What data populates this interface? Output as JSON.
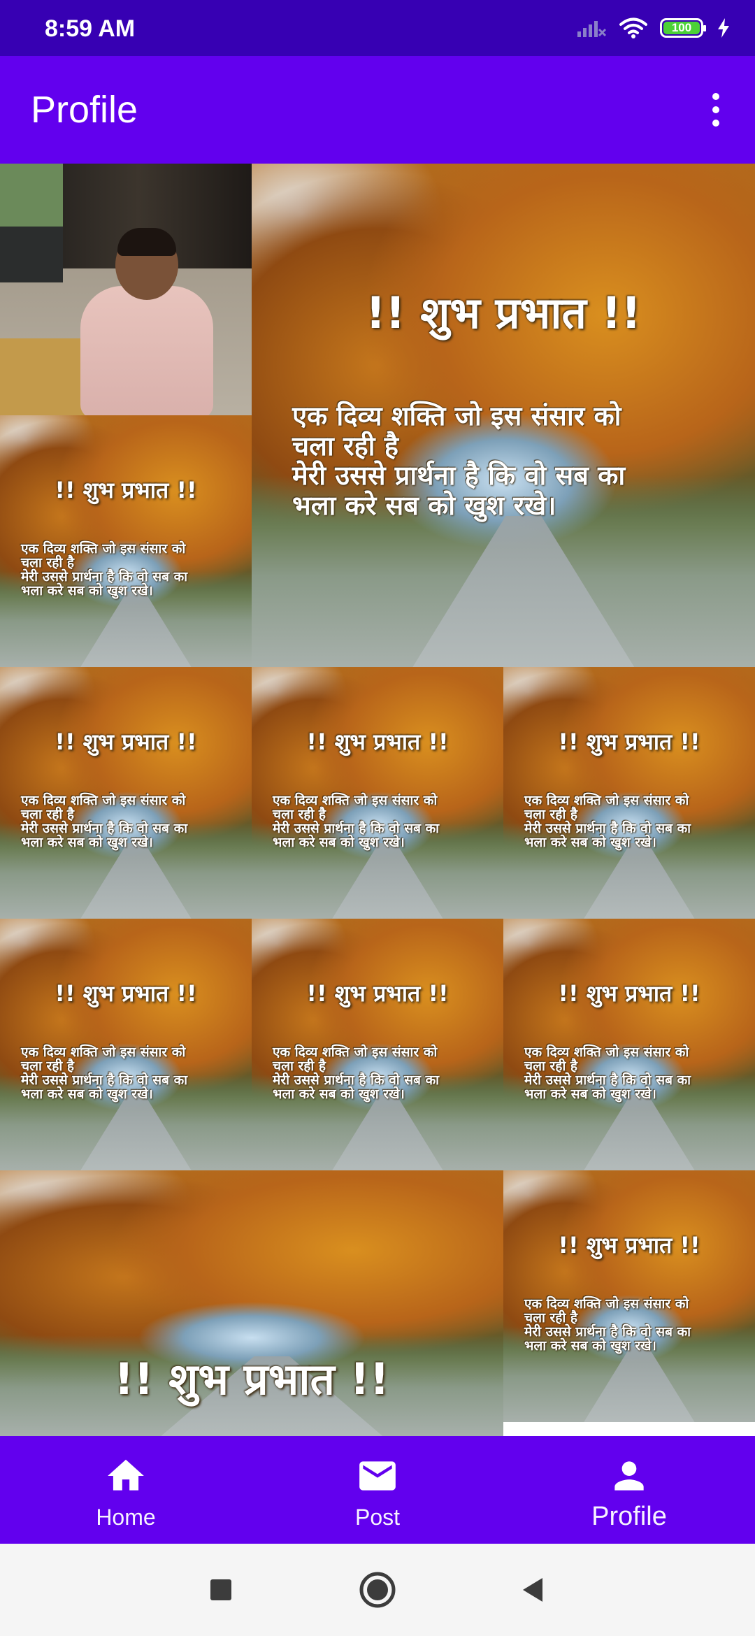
{
  "status_bar": {
    "time": "8:59 AM",
    "battery_level": "100",
    "icons": [
      "signal-off-icon",
      "wifi-icon",
      "battery-icon",
      "charging-bolt-icon"
    ]
  },
  "app_bar": {
    "title": "Profile",
    "menu_icon": "more-vertical-icon"
  },
  "posts": {
    "image_title": "!! शुभ प्रभात !!",
    "image_line_1": "एक दिव्य शक्ति जो इस संसार को",
    "image_line_2": "चला रही है",
    "image_line_3": "मेरी उससे प्रार्थना है कि वो सब का",
    "image_line_4": "भला करे सब को खुश रखे।"
  },
  "bottom_nav": {
    "items": [
      {
        "label": "Home",
        "icon": "home-icon",
        "active": false
      },
      {
        "label": "Post",
        "icon": "mail-icon",
        "active": false
      },
      {
        "label": "Profile",
        "icon": "person-icon",
        "active": true
      }
    ]
  },
  "system_nav": {
    "buttons": [
      "recents-square-icon",
      "home-circle-icon",
      "back-triangle-icon"
    ]
  },
  "colors": {
    "status_bar": "#3700b3",
    "primary": "#6200ee",
    "on_primary": "#ffffff",
    "system_nav_bg": "#f5f5f5"
  }
}
